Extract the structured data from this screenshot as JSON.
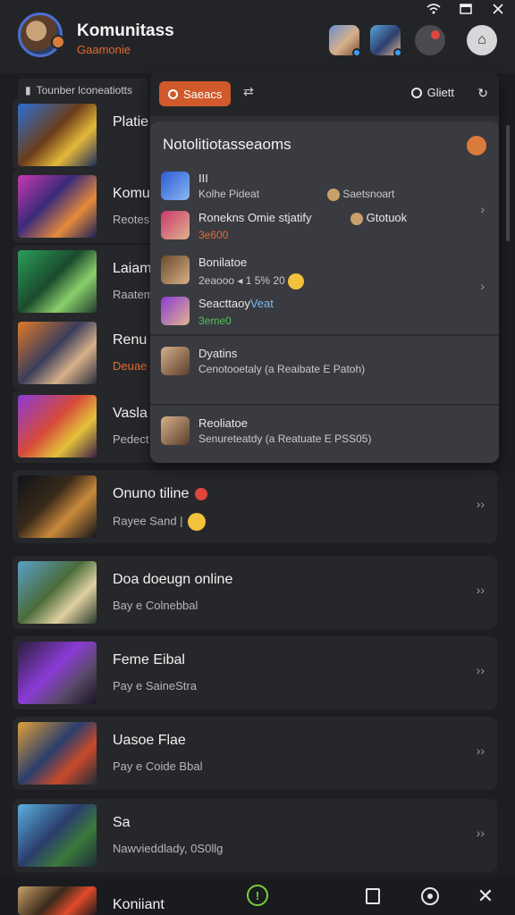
{
  "header": {
    "title": "Komunitass",
    "subtitle": "Gaamonie"
  },
  "filter": {
    "label": "Tounber lconeatiotts"
  },
  "dropdown": {
    "season_label": "Saeacs",
    "right_label": "Gliett",
    "panel": {
      "title": "Notolitiotasseaoms",
      "rows": [
        {
          "title": "III",
          "line": "Kolhe Pideat",
          "side": "Saetsnoart",
          "chevron": "›"
        },
        {
          "title": "Ronekns",
          "line": "Omie stjatify",
          "side": "Gtotuok",
          "status": "3e600"
        },
        {
          "title": "Bonilatoe",
          "line": "2eaooo",
          "extra": "1 5% 20",
          "chevron": "›"
        },
        {
          "title": "Seacttaoy",
          "highlight": "Veat",
          "status": "3eme0"
        },
        {
          "title": "Dyatins",
          "line": "Cenotooetaly (a Reaibate E Patoh)"
        },
        {
          "title": "Reoliatoe",
          "line": "Senureteatdy (a Reatuate E PSS05)"
        }
      ]
    }
  },
  "cards": [
    {
      "name": "Platie",
      "status": ""
    },
    {
      "name": "Komu",
      "status": "Reotes"
    },
    {
      "name": "Laiam",
      "status": "Raatem"
    },
    {
      "name": "Renu",
      "status": "Deuae"
    },
    {
      "name": "Vasla",
      "status": "Pedect"
    },
    {
      "name": "Onuno tiline",
      "status": "Rayee Sand |",
      "chevron": "››"
    },
    {
      "name": "Doa doeugn online",
      "status": "Bay e Colnebbal",
      "chevron": "››"
    },
    {
      "name": "Feme Eibal",
      "status": "Pay e SaineStra",
      "chevron": "››"
    },
    {
      "name": "Uasoe Flae",
      "status": "Pay e Coide Bbal",
      "chevron": "››"
    },
    {
      "name": "Sa",
      "status": "Nawvieddlady, 0S0llg",
      "chevron": "››"
    }
  ],
  "bottom_nav": {
    "title": "Koniiant"
  },
  "colors": {
    "accent": "#d05a2c",
    "background": "#1d1e21",
    "online_green": "#4fc45a",
    "home_green": "#7ad03a"
  }
}
